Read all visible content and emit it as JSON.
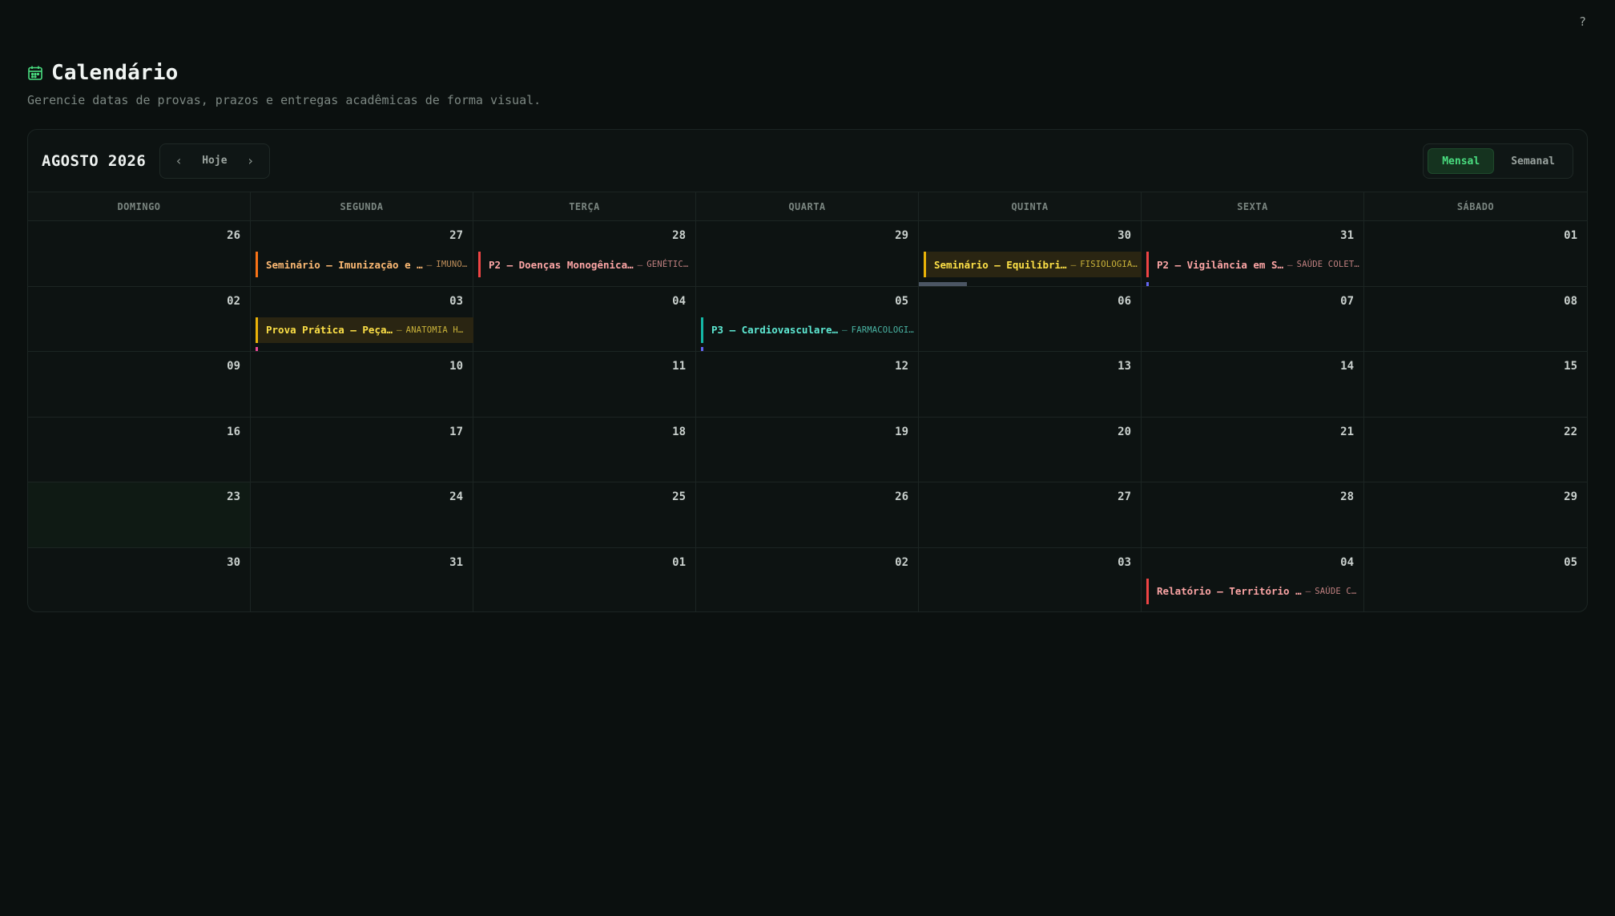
{
  "help": {
    "label": "?"
  },
  "header": {
    "title": "Calendário",
    "subtitle": "Gerencie datas de provas, prazos e entregas acadêmicas de forma visual."
  },
  "toolbar": {
    "month": "AGOSTO 2026",
    "prev_icon": "chevron-left-icon",
    "next_icon": "chevron-right-icon",
    "prev": "‹",
    "next": "›",
    "today": "Hoje",
    "views": [
      {
        "label": "Mensal",
        "active": true
      },
      {
        "label": "Semanal",
        "active": false
      }
    ]
  },
  "weekdays": [
    "DOMINGO",
    "SEGUNDA",
    "TERÇA",
    "QUARTA",
    "QUINTA",
    "SEXTA",
    "SÁBADO"
  ],
  "weeks": [
    [
      "26",
      "27",
      "28",
      "29",
      "30",
      "31",
      "01"
    ],
    [
      "02",
      "03",
      "04",
      "05",
      "06",
      "07",
      "08"
    ],
    [
      "09",
      "10",
      "11",
      "12",
      "13",
      "14",
      "15"
    ],
    [
      "16",
      "17",
      "18",
      "19",
      "20",
      "21",
      "22"
    ],
    [
      "23",
      "24",
      "25",
      "26",
      "27",
      "28",
      "29"
    ],
    [
      "30",
      "31",
      "01",
      "02",
      "03",
      "04",
      "05"
    ]
  ],
  "today_label": "23",
  "events": [
    {
      "title": "Seminário — Imunização e …",
      "tag": "IMUNO…",
      "color": "#f97316"
    },
    {
      "title": "P2 — Doenças Monogênica…",
      "tag": "GENÉTIC…",
      "color": "#ef4444"
    },
    {
      "title": "Seminário — Equilíbri…",
      "tag": "FISIOLOGIA…",
      "color": "#eab308"
    },
    {
      "title": "P2 — Vigilância em S…",
      "tag": "SAÚDE COLET…",
      "color": "#ef4444"
    },
    {
      "title": "Prova Prática — Peça…",
      "tag": "ANATOMIA H…",
      "color": "#eab308"
    },
    {
      "title": "P3 — Cardiovasculare…",
      "tag": "FARMACOLOGI…",
      "color": "#14b8a6"
    },
    {
      "title": "Relatório — Território …",
      "tag": "SAÚDE C…",
      "color": "#ef4444"
    }
  ],
  "separator": "—",
  "colors": {
    "accent": "#4ade80",
    "background": "#0b100f",
    "card": "#0d1312"
  }
}
